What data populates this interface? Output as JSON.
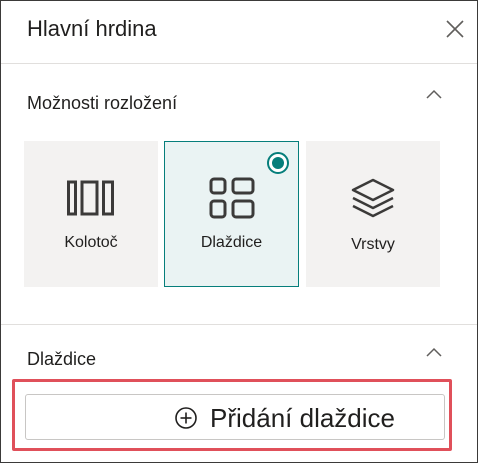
{
  "panel": {
    "title": "Hlavní hrdina"
  },
  "header": {
    "close_icon": "close-icon"
  },
  "layout_section": {
    "title": "Možnosti rozložení",
    "expanded": true,
    "options": [
      {
        "label": "Kolotoč",
        "icon": "carousel-icon",
        "selected": false
      },
      {
        "label": "Dlaždice",
        "icon": "tiles-icon",
        "selected": true
      },
      {
        "label": "Vrstvy",
        "icon": "layers-icon",
        "selected": false
      }
    ]
  },
  "tiles_section": {
    "title": "Dlaždice",
    "expanded": true,
    "add_button": {
      "label": "Přidání dlaždice",
      "icon": "plus-circle-icon"
    }
  },
  "colors": {
    "accent": "#067e7b",
    "highlight": "#e0505a",
    "option_bg": "#f3f2f1"
  }
}
